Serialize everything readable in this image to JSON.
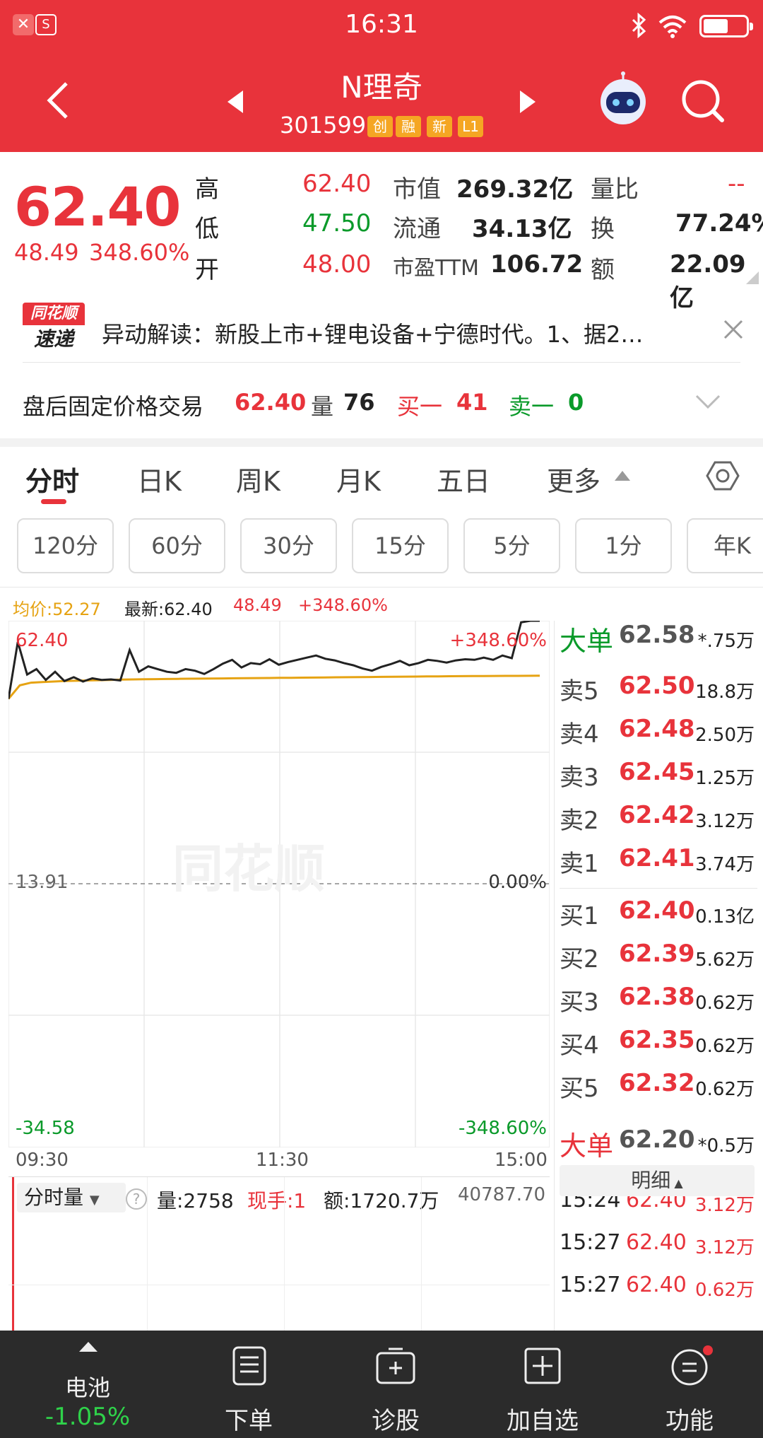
{
  "status": {
    "time": "16:31"
  },
  "header": {
    "title": "N理奇",
    "code": "301599",
    "tags": [
      "创",
      "融",
      "新",
      "L1"
    ]
  },
  "quote": {
    "price": "62.40",
    "change": "48.49",
    "change_pct": "348.60%",
    "high_label": "高",
    "high": "62.40",
    "low_label": "低",
    "low": "47.50",
    "open_label": "开",
    "open": "48.00",
    "mktcap_label": "市值",
    "mktcap": "269.32亿",
    "float_label": "流通",
    "float": "34.13亿",
    "pe_label": "市盈TTM",
    "pe": "106.72",
    "volratio_label": "量比",
    "volratio": "--",
    "turnover_label": "换",
    "turnover": "77.24%",
    "amount_label": "额",
    "amount": "22.09亿"
  },
  "news": {
    "logo_top": "同花顺",
    "logo_bottom": "速递",
    "text": "异动解读：新股上市+锂电设备+宁德时代。1、据2…"
  },
  "afterhours": {
    "label": "盘后固定价格交易",
    "price": "62.40",
    "vol_label": "量",
    "vol": "76",
    "buy_label": "买一",
    "buy": "41",
    "sell_label": "卖一",
    "sell": "0"
  },
  "tabs": [
    "分时",
    "日K",
    "周K",
    "月K",
    "五日",
    "更多"
  ],
  "periods": [
    "120分",
    "60分",
    "30分",
    "15分",
    "5分",
    "1分",
    "年K"
  ],
  "chart_info": {
    "avg": "均价:52.27",
    "latest": "最新:62.40",
    "chg": "48.49",
    "pct": "+348.60%"
  },
  "chart_data": {
    "type": "line",
    "y_left_top": "62.40",
    "y_left_mid": "13.91",
    "y_left_bottom": "-34.58",
    "y_right_top": "+348.60%",
    "y_right_mid": "0.00%",
    "y_right_bottom": "-348.60%",
    "x_labels": [
      "09:30",
      "11:30",
      "15:00"
    ],
    "ylim": [
      -34.58,
      62.4
    ],
    "series": [
      {
        "values": [
          48.0,
          58.5,
          52.5,
          53.5,
          51.5,
          53.0,
          51.3,
          52.0,
          51.2,
          51.8,
          51.5,
          51.6,
          51.4,
          57.0,
          53.0,
          54.0,
          53.5,
          53.0,
          52.8,
          53.5,
          53.2,
          52.6,
          53.5,
          54.5,
          55.2,
          53.8,
          54.6,
          54.4,
          55.3,
          54.3,
          54.8,
          55.2,
          55.6,
          56.0,
          55.4,
          55.1,
          54.6,
          54.2,
          53.6,
          53.2,
          53.9,
          54.4,
          55.0,
          54.2,
          54.6,
          55.2,
          55.0,
          54.7,
          55.1,
          55.3,
          55.2,
          55.6,
          55.2,
          56.0,
          55.5,
          62.1,
          62.4,
          62.4
        ]
      },
      {
        "values": [
          48.0,
          50.5,
          51.0,
          51.1,
          51.2,
          51.3,
          51.35,
          51.4,
          51.45,
          51.5,
          51.55,
          51.6,
          51.62,
          51.65,
          51.68,
          51.7,
          51.72,
          51.74,
          51.76,
          51.78,
          51.8,
          51.82,
          51.84,
          51.86,
          51.88,
          51.9,
          51.92,
          51.94,
          51.96,
          51.98,
          52.0,
          52.02,
          52.04,
          52.06,
          52.08,
          52.1,
          52.12,
          52.14,
          52.16,
          52.18,
          52.2,
          52.21,
          52.22,
          52.23,
          52.24,
          52.25,
          52.26,
          52.27
        ]
      }
    ],
    "colors": {
      "price": "#222222",
      "avg": "#e6a313"
    }
  },
  "orderbook": {
    "big_top": {
      "label": "大单",
      "price": "62.58",
      "vol": "*.75万"
    },
    "asks": [
      {
        "label": "卖5",
        "price": "62.50",
        "vol": "18.8万"
      },
      {
        "label": "卖4",
        "price": "62.48",
        "vol": "2.50万"
      },
      {
        "label": "卖3",
        "price": "62.45",
        "vol": "1.25万"
      },
      {
        "label": "卖2",
        "price": "62.42",
        "vol": "3.12万"
      },
      {
        "label": "卖1",
        "price": "62.41",
        "vol": "3.74万"
      }
    ],
    "bids": [
      {
        "label": "买1",
        "price": "62.40",
        "vol": "0.13亿"
      },
      {
        "label": "买2",
        "price": "62.39",
        "vol": "5.62万"
      },
      {
        "label": "买3",
        "price": "62.38",
        "vol": "0.62万"
      },
      {
        "label": "买4",
        "price": "62.35",
        "vol": "0.62万"
      },
      {
        "label": "买5",
        "price": "62.32",
        "vol": "0.62万"
      }
    ],
    "big_bottom": {
      "label": "大单",
      "price": "62.20",
      "vol": "*0.5万"
    },
    "detail_label": "明细",
    "ticks": [
      {
        "time": "15:24",
        "price": "62.40",
        "vol": "3.12万"
      },
      {
        "time": "15:27",
        "price": "62.40",
        "vol": "3.12万"
      },
      {
        "time": "15:27",
        "price": "62.40",
        "vol": "0.62万"
      }
    ]
  },
  "volume_panel": {
    "selector": "分时量",
    "vol": "量:2758",
    "hand": "现手:1",
    "amount": "额:1720.7万",
    "max": "40787.70"
  },
  "bottombar": {
    "battery_label": "电池",
    "battery_value": "-1.05%",
    "order": "下单",
    "diagnose": "诊股",
    "watchlist": "加自选",
    "functions": "功能"
  }
}
